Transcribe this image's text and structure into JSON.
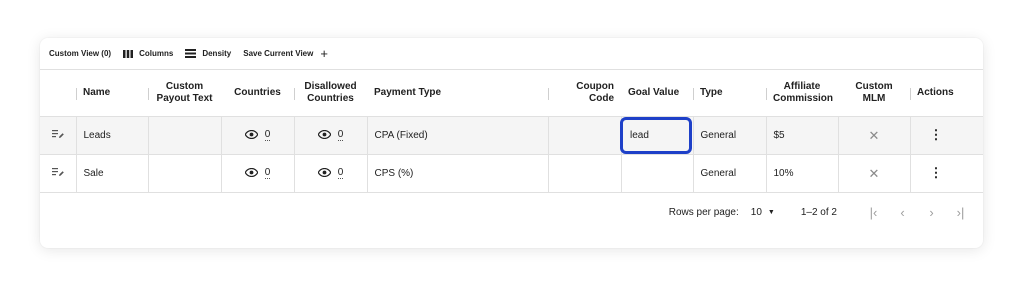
{
  "toolbar": {
    "custom_view": "Custom View (0)",
    "columns": "Columns",
    "density": "Density",
    "save_view": "Save Current View",
    "add": "+"
  },
  "columns": {
    "name": "Name",
    "custom_payout_1": "Custom",
    "custom_payout_2": "Payout Text",
    "countries": "Countries",
    "disallowed_1": "Disallowed",
    "disallowed_2": "Countries",
    "payment_type": "Payment Type",
    "coupon_code": "Coupon Code",
    "goal_value": "Goal Value",
    "type": "Type",
    "affiliate_1": "Affiliate",
    "affiliate_2": "Commission",
    "custom_mlm": "Custom MLM",
    "actions": "Actions"
  },
  "rows": [
    {
      "name": "Leads",
      "countries": "0",
      "disallowed": "0",
      "payment_type": "CPA (Fixed)",
      "goal_value": "lead",
      "type": "General",
      "commission": "$5"
    },
    {
      "name": "Sale",
      "countries": "0",
      "disallowed": "0",
      "payment_type": "CPS (%)",
      "goal_value": "",
      "type": "General",
      "commission": "10%"
    }
  ],
  "footer": {
    "rows_per_page_label": "Rows per page:",
    "rows_per_page_value": "10",
    "range": "1–2 of 2"
  },
  "icons": {
    "edit": "edit-list-icon",
    "eye": "eye-icon",
    "close": "x-icon",
    "menu": "more-vertical-icon"
  },
  "colors": {
    "highlight": "#1e40c8",
    "selected_row": "#f5f5f5"
  }
}
